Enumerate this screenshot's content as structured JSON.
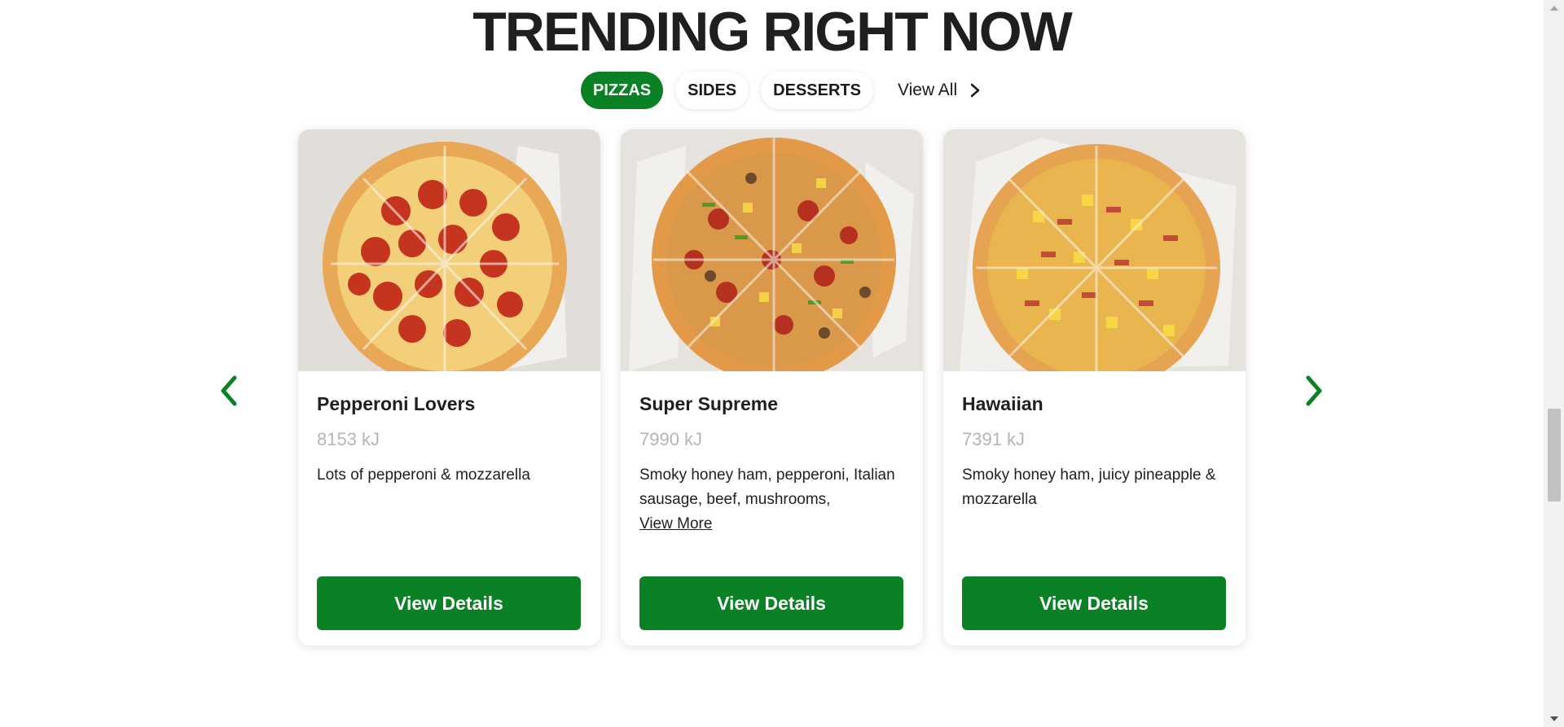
{
  "section": {
    "title": "TRENDING RIGHT NOW"
  },
  "tabs": [
    {
      "label": "PIZZAS",
      "active": true
    },
    {
      "label": "SIDES",
      "active": false
    },
    {
      "label": "DESSERTS",
      "active": false
    }
  ],
  "view_all": {
    "label": "View All",
    "icon": "chevron-right-icon"
  },
  "carousel": {
    "prev_icon": "chevron-left-icon",
    "next_icon": "chevron-right-icon"
  },
  "cards": [
    {
      "name": "Pepperoni Lovers",
      "energy": "8153 kJ",
      "description": "Lots of pepperoni & mozzarella",
      "button": "View Details"
    },
    {
      "name": "Super Supreme",
      "energy": "7990 kJ",
      "description": "Smoky honey ham, pepperoni, Italian sausage, beef, mushrooms,",
      "view_more": "View More",
      "button": "View Details"
    },
    {
      "name": "Hawaiian",
      "energy": "7391 kJ",
      "description": "Smoky honey ham, juicy pineapple & mozzarella",
      "button": "View Details"
    }
  ],
  "colors": {
    "brand_green": "#0b8126",
    "muted_text": "#b5b5b5",
    "text": "#1f1f1f"
  }
}
